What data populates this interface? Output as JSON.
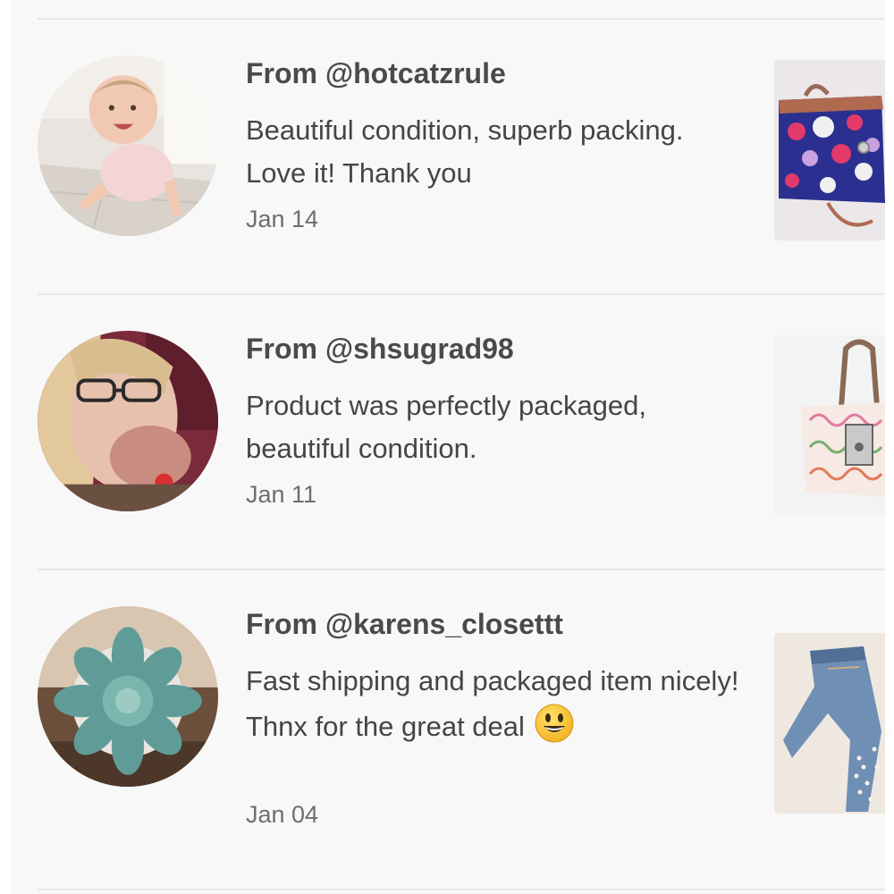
{
  "reviews": [
    {
      "from": "From @hotcatzrule",
      "comment": "Beautiful condition, superb packing. Love it! Thank you",
      "date": "Jan 14",
      "avatar_icon": "baby-photo",
      "item_icon": "dotted-handbag-photo"
    },
    {
      "from": "From @shsugrad98",
      "comment": "Product was perfectly packaged, beautiful condition.",
      "date": "Jan 11",
      "avatar_icon": "woman-glasses-photo",
      "item_icon": "signature-tote-photo"
    },
    {
      "from": "From @karens_closettt",
      "comment": "Fast shipping and packaged item nicely! Thnx for the great deal",
      "date": "Jan 04",
      "avatar_icon": "succulent-photo",
      "item_icon": "jeans-photo",
      "emoji": "smiley-emoji"
    }
  ],
  "colors": {
    "background": "#f8f8f8",
    "text_primary": "#4a4a4a",
    "text_secondary": "#6e6e6e",
    "divider": "#e6e6e6"
  }
}
